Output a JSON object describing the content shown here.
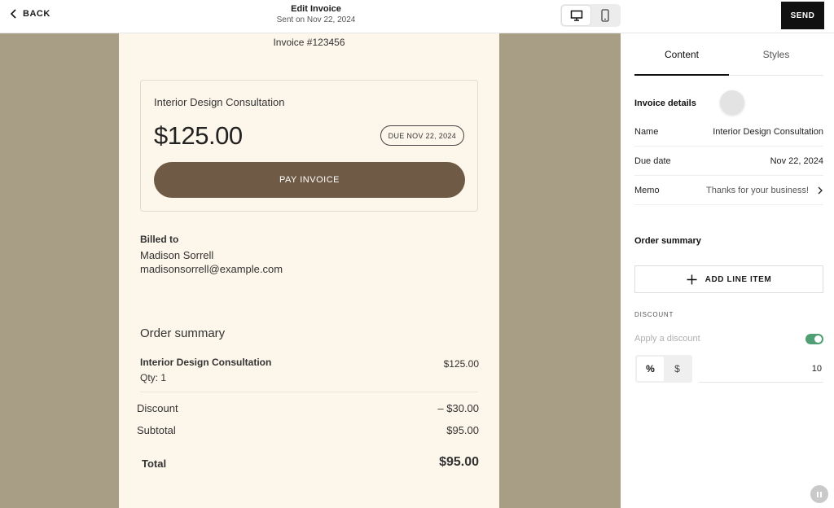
{
  "topbar": {
    "back_label": "BACK",
    "title": "Edit Invoice",
    "subtitle": "Sent on Nov 22, 2024",
    "send_label": "SEND",
    "devices": [
      "desktop-icon",
      "mobile-icon"
    ],
    "active_device": "desktop"
  },
  "invoice": {
    "number": "Invoice #123456",
    "card": {
      "item": "Interior Design Consultation",
      "amount": "$125.00",
      "due_badge": "DUE NOV 22, 2024",
      "pay_label": "PAY INVOICE"
    },
    "billed_to": {
      "label": "Billed to",
      "name": "Madison Sorrell",
      "email": "madisonsorrell@example.com"
    },
    "summary": {
      "title": "Order summary",
      "line_item": {
        "name": "Interior Design Consultation",
        "qty": "Qty: 1",
        "price": "$125.00"
      },
      "discount_label": "Discount",
      "discount_value": "– $30.00",
      "subtotal_label": "Subtotal",
      "subtotal_value": "$95.00",
      "total_label": "Total",
      "total_value": "$95.00"
    }
  },
  "panel": {
    "tabs": [
      {
        "label": "Content",
        "active": true
      },
      {
        "label": "Styles",
        "active": false
      }
    ],
    "invoice_details_title": "Invoice details",
    "fields": [
      {
        "label": "Name",
        "value": "Interior Design Consultation"
      },
      {
        "label": "Due date",
        "value": "Nov 22, 2024"
      },
      {
        "label": "Memo",
        "value": "Thanks for your business!"
      }
    ],
    "order_summary_title": "Order summary",
    "add_line_label": "ADD LINE ITEM",
    "discount_caption": "DISCOUNT",
    "apply_discount_label": "Apply a discount",
    "discount_enabled": true,
    "discount_types": [
      {
        "label": "%",
        "active": true
      },
      {
        "label": "$",
        "active": false
      }
    ],
    "discount_amount": "10"
  },
  "colors": {
    "preview_bg": "#a89e86",
    "paper_bg": "#fdf6ea",
    "pay_button": "#6f5a45",
    "toggle_on": "#4f9e74",
    "send_bg": "#111111"
  }
}
